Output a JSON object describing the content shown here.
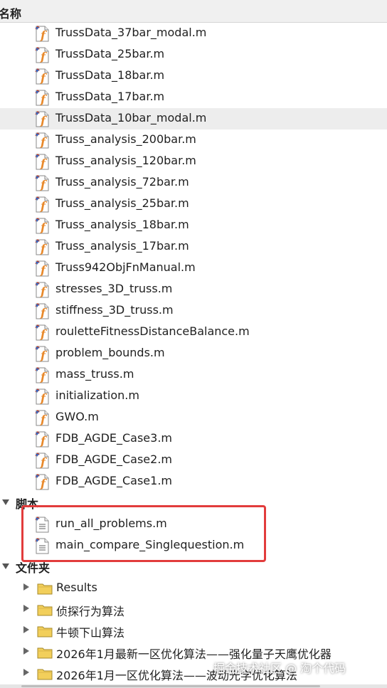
{
  "header": {
    "title": "名称"
  },
  "functions": [
    {
      "name": "TrussData_37bar_modal.m"
    },
    {
      "name": "TrussData_25bar.m"
    },
    {
      "name": "TrussData_18bar.m"
    },
    {
      "name": "TrussData_17bar.m"
    },
    {
      "name": "TrussData_10bar_modal.m",
      "selected": true
    },
    {
      "name": "Truss_analysis_200bar.m"
    },
    {
      "name": "Truss_analysis_120bar.m"
    },
    {
      "name": "Truss_analysis_72bar.m"
    },
    {
      "name": "Truss_analysis_25bar.m"
    },
    {
      "name": "Truss_analysis_18bar.m"
    },
    {
      "name": "Truss_analysis_17bar.m"
    },
    {
      "name": "Truss942ObjFnManual.m"
    },
    {
      "name": "stresses_3D_truss.m"
    },
    {
      "name": "stiffness_3D_truss.m"
    },
    {
      "name": "rouletteFitnessDistanceBalance.m"
    },
    {
      "name": "problem_bounds.m"
    },
    {
      "name": "mass_truss.m"
    },
    {
      "name": "initialization.m"
    },
    {
      "name": "GWO.m"
    },
    {
      "name": "FDB_AGDE_Case3.m"
    },
    {
      "name": "FDB_AGDE_Case2.m"
    },
    {
      "name": "FDB_AGDE_Case1.m"
    }
  ],
  "scripts_group": {
    "label": "脚本"
  },
  "scripts": [
    {
      "name": "run_all_problems.m"
    },
    {
      "name": "main_compare_Singlequestion.m"
    }
  ],
  "folders_group": {
    "label": "文件夹"
  },
  "folders": [
    {
      "name": "Results"
    },
    {
      "name": "侦探行为算法"
    },
    {
      "name": "牛顿下山算法"
    },
    {
      "name": "2026年1月最新一区优化算法——强化量子天鹰优化器"
    },
    {
      "name": "2026年1月一区优化算法——波动光学优化算法"
    }
  ],
  "watermark": "掘金技术社区 @ 淘个代码",
  "colors": {
    "highlight": "#e23c3c",
    "function_icon": "#e8892b",
    "folder_icon": "#f2cf5b"
  }
}
